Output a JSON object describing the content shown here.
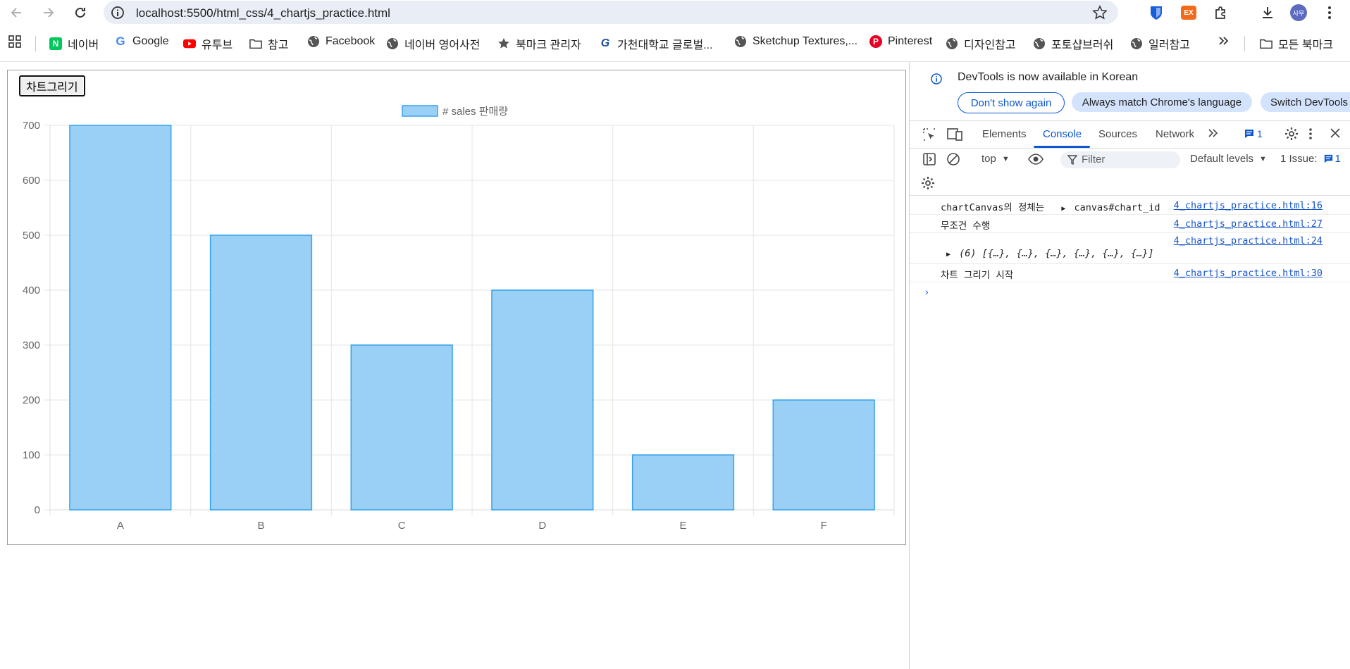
{
  "browser": {
    "url": "localhost:5500/html_css/4_chartjs_practice.html",
    "profile_initial": "사우"
  },
  "bookmarks": {
    "items": [
      {
        "label": "네이버",
        "icon": "naver-icon"
      },
      {
        "label": "Google",
        "icon": "google-icon"
      },
      {
        "label": "유투브",
        "icon": "youtube-icon"
      },
      {
        "label": "참고",
        "icon": "folder-icon"
      },
      {
        "label": "Facebook",
        "icon": "globe-icon"
      },
      {
        "label": "네이버 영어사전",
        "icon": "globe-icon"
      },
      {
        "label": "북마크 관리자",
        "icon": "star-icon"
      },
      {
        "label": "가천대학교 글로벌...",
        "icon": "gachon-icon"
      },
      {
        "label": "Sketchup Textures,...",
        "icon": "globe-icon"
      },
      {
        "label": "Pinterest",
        "icon": "pinterest-icon"
      },
      {
        "label": "디자인참고",
        "icon": "globe-icon"
      },
      {
        "label": "포토샵브러쉬",
        "icon": "globe-icon"
      },
      {
        "label": "일러참고",
        "icon": "globe-icon"
      }
    ],
    "all_bookmarks": "모든 북마크"
  },
  "page": {
    "draw_button": "차트그리기"
  },
  "chart_data": {
    "type": "bar",
    "categories": [
      "A",
      "B",
      "C",
      "D",
      "E",
      "F"
    ],
    "series": [
      {
        "name": "# sales 판매량",
        "values": [
          700,
          500,
          300,
          400,
          100,
          200
        ]
      }
    ],
    "yticks": [
      "0",
      "100",
      "200",
      "300",
      "400",
      "500",
      "600",
      "700"
    ],
    "ylim": [
      0,
      700
    ],
    "legend_position": "top",
    "grid": true,
    "bar_fill": "#9ad0f5",
    "bar_stroke": "#36a2eb"
  },
  "devtools": {
    "banner_message": "DevTools is now available in Korean",
    "btn_dont_show": "Don't show again",
    "btn_always_match": "Always match Chrome's language",
    "btn_switch": "Switch DevTools",
    "tabs": [
      "Elements",
      "Console",
      "Sources",
      "Network"
    ],
    "issue_badge_count": "1",
    "context": "top",
    "filter_placeholder": "Filter",
    "levels": "Default levels",
    "issues_label": "1 Issue:",
    "issues_count": "1",
    "console": [
      {
        "text": "chartCanvas의 정체는",
        "obj": "canvas#chart_id",
        "source": "4_chartjs_practice.html:16"
      },
      {
        "text": "무조건 수행",
        "source": "4_chartjs_practice.html:27"
      },
      {
        "text": "(6) [{…}, {…}, {…}, {…}, {…}, {…}]",
        "source": "4_chartjs_practice.html:24"
      },
      {
        "text": "차트 그리기 시작",
        "source": "4_chartjs_practice.html:30"
      }
    ]
  }
}
